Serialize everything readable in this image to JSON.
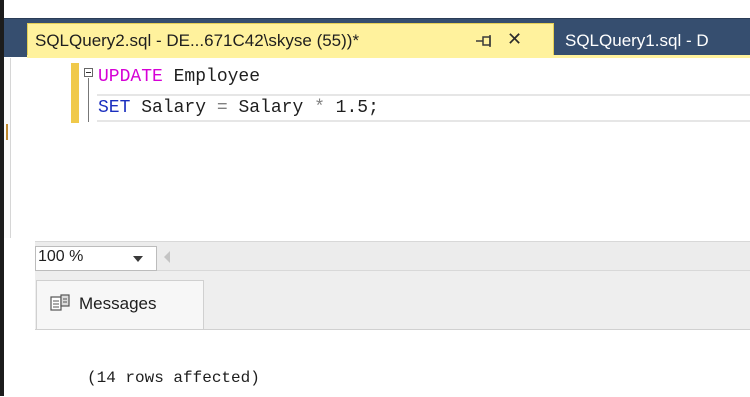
{
  "tabs": {
    "active": {
      "title": "SQLQuery2.sql - DE...671C42\\skyse (55))*",
      "pin_icon": "pin-icon",
      "close_icon": "close-icon",
      "close_glyph": "✕"
    },
    "inactive": {
      "title": "SQLQuery1.sql - D"
    }
  },
  "editor": {
    "line1": {
      "keyword": "UPDATE",
      "table": " Employee"
    },
    "line2": {
      "keyword": "SET",
      "ident1": " Salary ",
      "eq": "=",
      "ident2": " Salary ",
      "op": "*",
      "value": " 1.5;"
    }
  },
  "zoom": {
    "value": "100 %"
  },
  "results": {
    "tab_label": "Messages",
    "message": "(14 rows affected)"
  },
  "colors": {
    "active_tab_bg": "#fff29d",
    "tabbar_bg": "#364e6f",
    "keyword_pink": "#d600d6",
    "keyword_blue": "#1b2fbf"
  }
}
